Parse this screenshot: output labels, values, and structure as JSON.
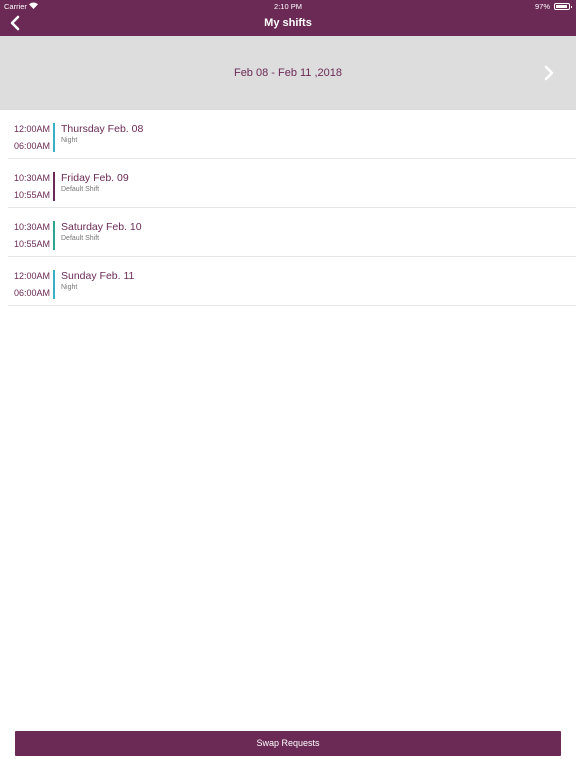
{
  "status_bar": {
    "carrier": "Carrier",
    "time": "2:10 PM",
    "battery": "97%",
    "wifi_icon": "wifi-icon",
    "battery_icon": "battery-icon"
  },
  "nav": {
    "title": "My shifts",
    "back_icon": "chevron-left-icon"
  },
  "week": {
    "range": "Feb 08 - Feb 11 ,2018",
    "next_icon": "chevron-right-icon"
  },
  "shifts": [
    {
      "start": "12:00AM",
      "end": "06:00AM",
      "day": "Thursday Feb. 08",
      "type": "Night",
      "color": "#3aafc7"
    },
    {
      "start": "10:30AM",
      "end": "10:55AM",
      "day": "Friday Feb. 09",
      "type": "Default Shift",
      "color": "#6b2a56"
    },
    {
      "start": "10:30AM",
      "end": "10:55AM",
      "day": "Saturday Feb. 10",
      "type": "Default Shift",
      "color": "#2ea58f"
    },
    {
      "start": "12:00AM",
      "end": "06:00AM",
      "day": "Sunday Feb. 11",
      "type": "Night",
      "color": "#3aafc7"
    }
  ],
  "footer": {
    "swap_label": "Swap Requests"
  },
  "colors": {
    "brand": "#6b2a56",
    "header_bg": "#dddddd",
    "divider": "#e6e6e6"
  }
}
